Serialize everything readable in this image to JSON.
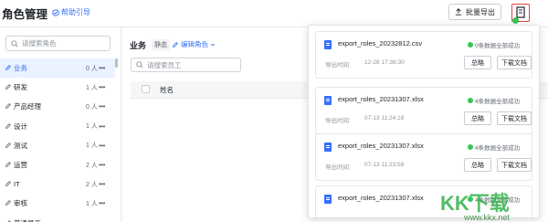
{
  "header": {
    "title": "角色管理",
    "help_link": "帮助引导",
    "batch_export": "批量导出"
  },
  "sidebar": {
    "search_placeholder": "请搜索角色",
    "roles": [
      {
        "name": "业务",
        "count": "0 人",
        "active": true
      },
      {
        "name": "研发",
        "count": "1 人",
        "active": false
      },
      {
        "name": "产品经理",
        "count": "0 人",
        "active": false
      },
      {
        "name": "设计",
        "count": "1 人",
        "active": false
      },
      {
        "name": "测试",
        "count": "1 人",
        "active": false
      },
      {
        "name": "运营",
        "count": "2 人",
        "active": false
      },
      {
        "name": "IT",
        "count": "2 人",
        "active": false
      },
      {
        "name": "审核",
        "count": "1 人",
        "active": false
      },
      {
        "name": "普通员工",
        "count": "",
        "active": false
      }
    ]
  },
  "main": {
    "title": "业务",
    "tag": "静态",
    "edit_role": "编辑角色",
    "search_placeholder": "请搜索员工",
    "column_name": "姓名"
  },
  "export_panel": {
    "time_label": "导出时间:",
    "summary_label": "总略",
    "download_label": "下载文档",
    "tasks": [
      {
        "file": "export_roles_20232812.csv",
        "status": "0条数据全部成功",
        "time": "12-28 17:36:30"
      },
      {
        "file": "export_roles_20231307.xlsx",
        "status": "4条数据全部成功",
        "time": "07-13 11:24:18"
      },
      {
        "file": "export_roles_20231307.xlsx",
        "status": "4条数据全部成功",
        "time": "07-13 11:23:58"
      },
      {
        "file": "export_roles_20231307.xlsx",
        "status": "4条数据全部成功",
        "time": ""
      }
    ]
  },
  "watermark": {
    "text": "KK下载",
    "url": "www.kkx.net"
  },
  "colors": {
    "accent": "#3370ff",
    "success": "#34c759",
    "highlight_border": "#e5443a"
  }
}
